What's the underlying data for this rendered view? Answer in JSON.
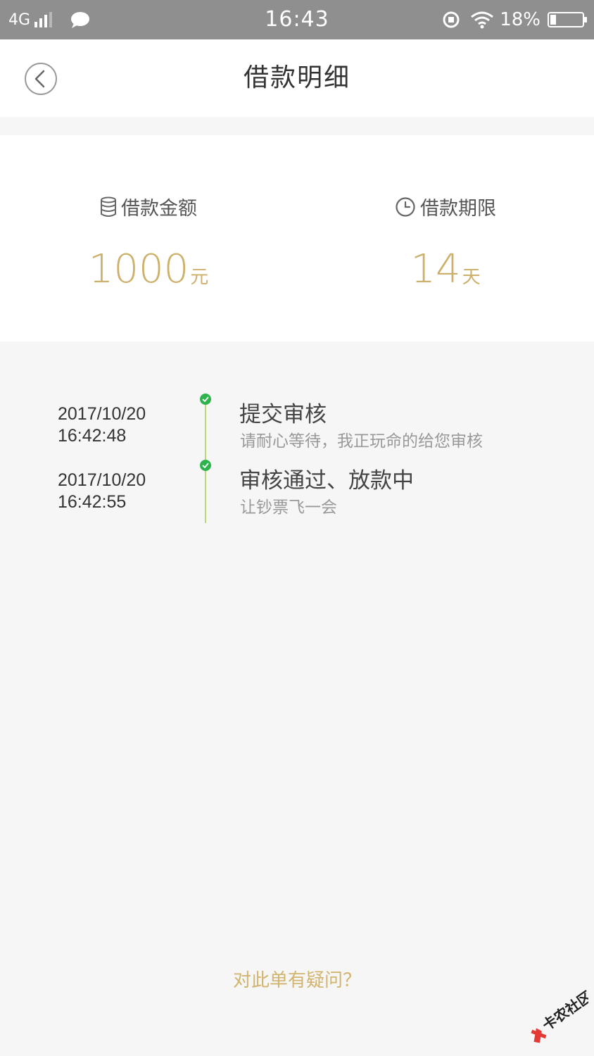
{
  "status_bar": {
    "network": "4G",
    "time": "16:43",
    "battery_percent": "18%",
    "battery_level": 0.18,
    "icons": [
      "signal-icon",
      "chat-icon",
      "rotation-lock-icon",
      "wifi-icon",
      "battery-icon"
    ]
  },
  "header": {
    "title": "借款明细",
    "back_icon": "chevron-left-circle-icon"
  },
  "summary": {
    "amount": {
      "label": "借款金额",
      "icon": "coin-stack-icon",
      "value": "1000",
      "unit": "元"
    },
    "term": {
      "label": "借款期限",
      "icon": "clock-icon",
      "value": "14",
      "unit": "天"
    }
  },
  "timeline": {
    "items": [
      {
        "date": "2017/10/20",
        "time": "16:42:48",
        "title": "提交审核",
        "desc": "请耐心等待，我正玩命的给您审核",
        "status": "done"
      },
      {
        "date": "2017/10/20",
        "time": "16:42:55",
        "title": "审核通过、放款中",
        "desc": "让钞票飞一会",
        "status": "done"
      }
    ]
  },
  "footer": {
    "question_link": "对此单有疑问？"
  },
  "watermark": {
    "text": "卡农社区"
  },
  "colors": {
    "accent_gold": "#cdb06b",
    "timeline_green": "#2db34b",
    "timeline_line": "#b9d87a",
    "status_bar_bg": "#8f8f8f",
    "page_bg": "#f6f6f6"
  }
}
